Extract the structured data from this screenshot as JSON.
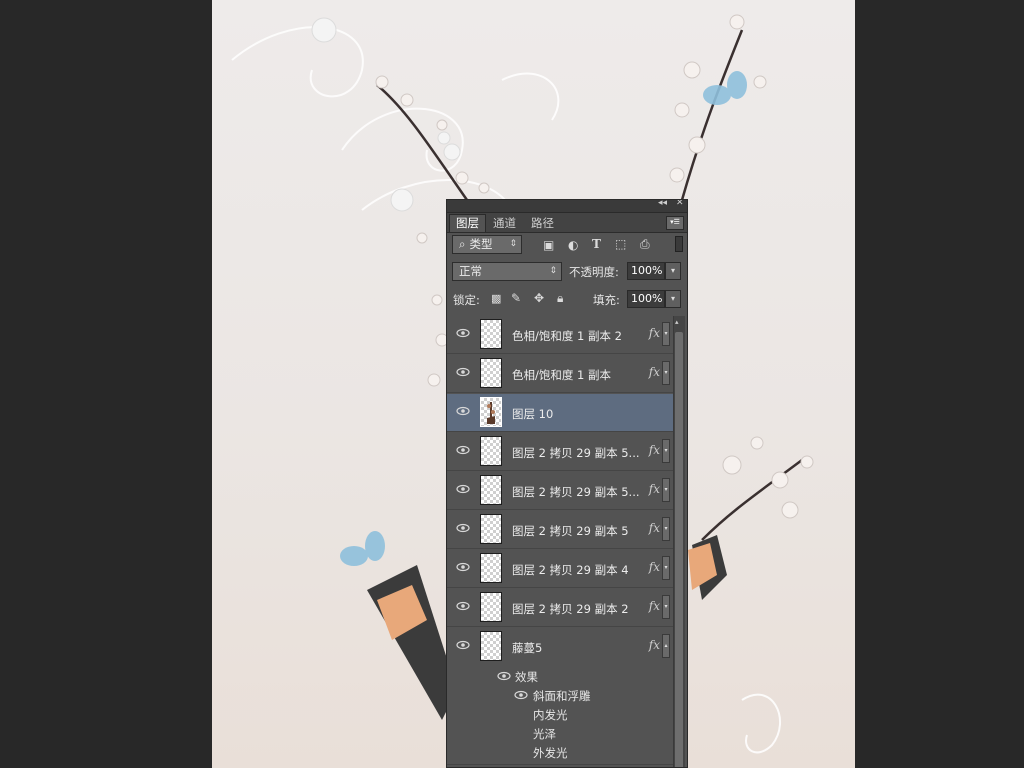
{
  "panel": {
    "controls": [
      "◂◂",
      "✕"
    ],
    "tabs": [
      "图层",
      "通道",
      "路径"
    ],
    "filter_kind": "类型",
    "blend_mode": "正常",
    "opacity_label": "不透明度:",
    "opacity_value": "100%",
    "lock_label": "锁定:",
    "fill_label": "填充:",
    "fill_value": "100%",
    "fx_glyph": "fx",
    "layers": [
      {
        "name": "色相/饱和度 1 副本 2"
      },
      {
        "name": "色相/饱和度 1 副本"
      },
      {
        "name": "图层 10"
      },
      {
        "name": "图层 2 拷贝 29 副本 5..."
      },
      {
        "name": "图层 2 拷贝 29 副本 5..."
      },
      {
        "name": "图层 2 拷贝 29 副本 5"
      },
      {
        "name": "图层 2 拷贝 29 副本 4"
      },
      {
        "name": "图层 2 拷贝 29 副本 2"
      },
      {
        "name": "藤蔓5"
      }
    ],
    "effects_label": "效果",
    "effects": [
      "斜面和浮雕",
      "内发光",
      "光泽",
      "外发光"
    ]
  },
  "colors": {
    "panel_bg": "#535353",
    "selected_row": "#5e6c80",
    "workspace_bg": "#282828"
  }
}
